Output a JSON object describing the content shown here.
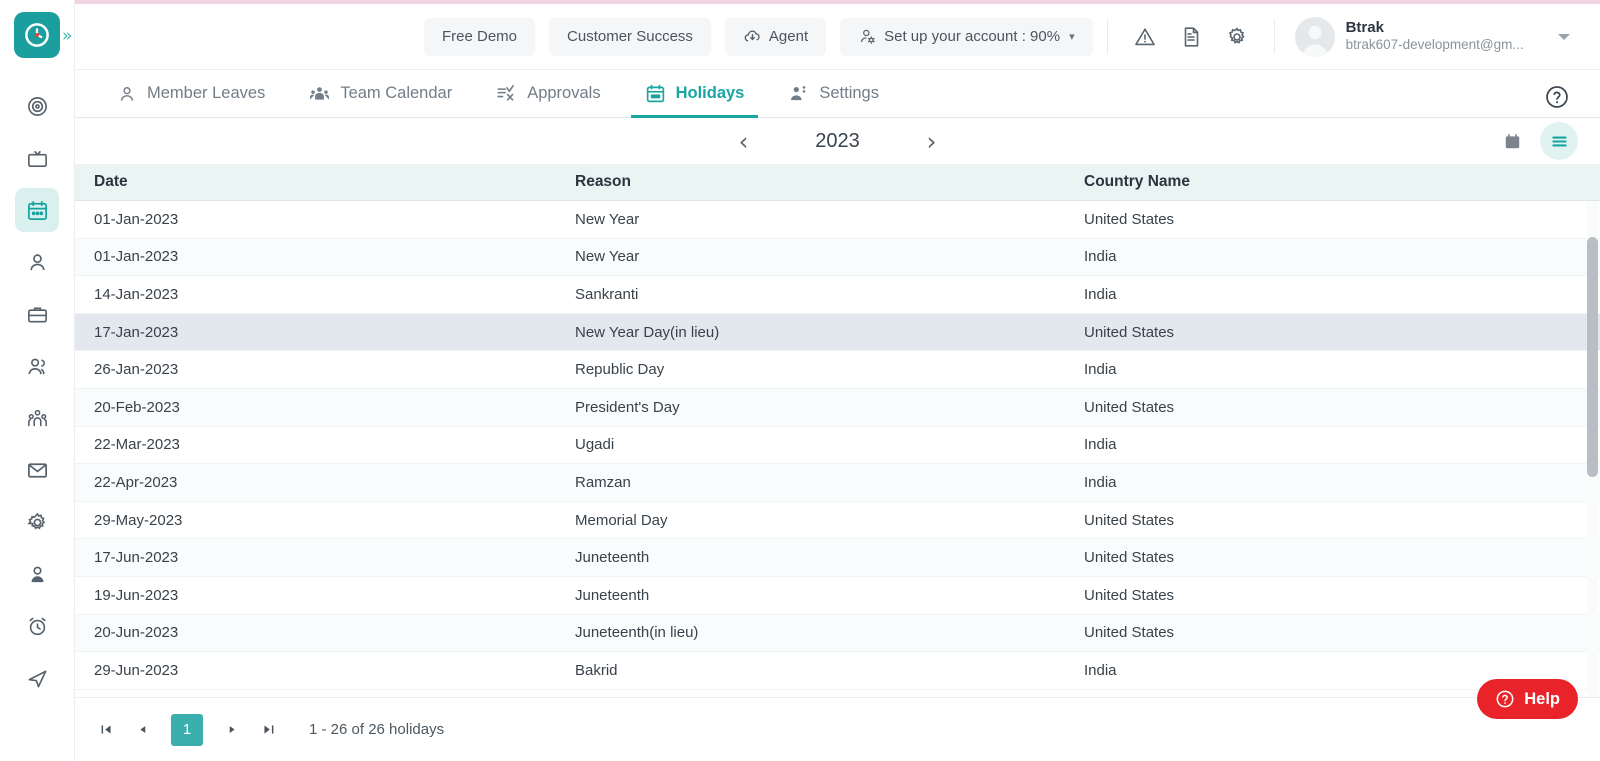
{
  "topbar": {
    "buttons": [
      {
        "label": "Free Demo",
        "icon": "none"
      },
      {
        "label": "Customer Success",
        "icon": "none"
      },
      {
        "label": "Agent",
        "icon": "cloud-download-icon"
      },
      {
        "label": "Set up your account : 90%",
        "icon": "user-gear-icon",
        "caret": "▾"
      }
    ],
    "icons": [
      "warning-triangle-icon",
      "document-icon",
      "gear-icon"
    ],
    "user": {
      "name": "Btrak",
      "email": "btrak607-development@gm...",
      "avatar": "avatar-icon"
    }
  },
  "tabs": [
    {
      "label": "Member Leaves",
      "icon": "person-icon",
      "active": false
    },
    {
      "label": "Team Calendar",
      "icon": "group-icon",
      "active": false
    },
    {
      "label": "Approvals",
      "icon": "approvals-icon",
      "active": false
    },
    {
      "label": "Holidays",
      "icon": "calendar-icon",
      "active": true
    },
    {
      "label": "Settings",
      "icon": "person-settings-icon",
      "active": false
    }
  ],
  "help_icon": "question-circle-icon",
  "yearbar": {
    "prev": "‹",
    "year": "2023",
    "next": "›",
    "tools": [
      {
        "name": "calendar-view-icon",
        "active": false
      },
      {
        "name": "list-view-icon",
        "active": true
      }
    ]
  },
  "table": {
    "columns": [
      "Date",
      "Reason",
      "Country Name"
    ],
    "rows": [
      {
        "date": "01-Jan-2023",
        "reason": "New Year",
        "country": "United States"
      },
      {
        "date": "01-Jan-2023",
        "reason": "New Year",
        "country": "India"
      },
      {
        "date": "14-Jan-2023",
        "reason": "Sankranti",
        "country": "India"
      },
      {
        "date": "17-Jan-2023",
        "reason": "New Year Day(in lieu)",
        "country": "United States"
      },
      {
        "date": "26-Jan-2023",
        "reason": "Republic Day",
        "country": "India"
      },
      {
        "date": "20-Feb-2023",
        "reason": "President's Day",
        "country": "United States"
      },
      {
        "date": "22-Mar-2023",
        "reason": "Ugadi",
        "country": "India"
      },
      {
        "date": "22-Apr-2023",
        "reason": "Ramzan",
        "country": "India"
      },
      {
        "date": "29-May-2023",
        "reason": "Memorial Day",
        "country": "United States"
      },
      {
        "date": "17-Jun-2023",
        "reason": "Juneteenth",
        "country": "United States"
      },
      {
        "date": "19-Jun-2023",
        "reason": "Juneteenth",
        "country": "United States"
      },
      {
        "date": "20-Jun-2023",
        "reason": "Juneteenth(in lieu)",
        "country": "United States"
      },
      {
        "date": "29-Jun-2023",
        "reason": "Bakrid",
        "country": "India"
      }
    ],
    "selected_row_index": 3
  },
  "pagination": {
    "first": "⏮",
    "prev": "◀",
    "page": "1",
    "next": "▶",
    "last": "⏭",
    "info": "1 - 26 of 26 holidays"
  },
  "help_button": {
    "label": "Help",
    "icon": "question-circle-icon",
    "color": "#e8242a"
  },
  "sidebar": {
    "logo": "clock-logo-icon",
    "expand": "»",
    "items": [
      {
        "name": "target-icon",
        "active": false
      },
      {
        "name": "tv-icon",
        "active": false
      },
      {
        "name": "calendar-icon",
        "active": true
      },
      {
        "name": "person-icon",
        "active": false
      },
      {
        "name": "briefcase-icon",
        "active": false
      },
      {
        "name": "users-icon",
        "active": false
      },
      {
        "name": "team-icon",
        "active": false
      },
      {
        "name": "mail-icon",
        "active": false
      },
      {
        "name": "gear-icon",
        "active": false
      },
      {
        "name": "user-filled-icon",
        "active": false
      },
      {
        "name": "alarm-clock-icon",
        "active": false
      },
      {
        "name": "send-icon",
        "active": false
      }
    ]
  },
  "theme": {
    "accent": "#19a6a2",
    "header_bg": "#e9f4f3",
    "selected_row": "#e3e7ee"
  }
}
